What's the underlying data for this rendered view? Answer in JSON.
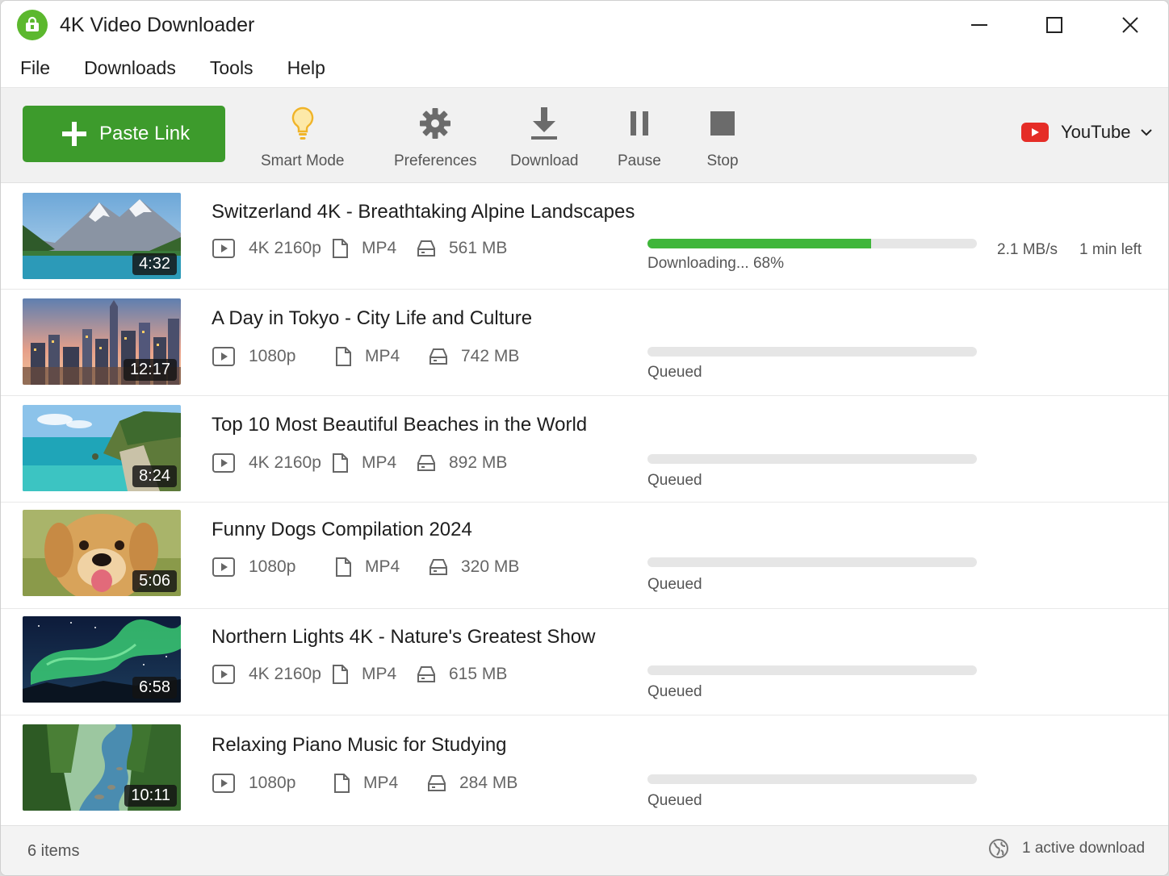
{
  "app": {
    "title": "4K Video Downloader",
    "accent": "#3d9b2c"
  },
  "menu": [
    "File",
    "Downloads",
    "Tools",
    "Help"
  ],
  "toolbar": {
    "paste_label": "Paste Link",
    "smart_mode_label": "Smart Mode",
    "preferences_label": "Preferences",
    "download_label": "Download",
    "pause_label": "Pause",
    "stop_label": "Stop",
    "site": "YouTube"
  },
  "downloads": [
    {
      "title": "Switzerland 4K - Breathtaking Alpine Landscapes",
      "quality": "4K 2160p",
      "format": "MP4",
      "size": "561 MB",
      "duration": "4:32",
      "status": "Downloading... 68%",
      "progress": 0.68,
      "speed": "2.1 MB/s",
      "eta": "1 min left",
      "thumb": "mountain"
    },
    {
      "title": "A Day in Tokyo - City Life and Culture",
      "quality": "1080p",
      "format": "MP4",
      "size": "742 MB",
      "duration": "12:17",
      "status": "Queued",
      "progress": 0,
      "thumb": "city"
    },
    {
      "title": "Top 10 Most Beautiful Beaches in the World",
      "quality": "4K 2160p",
      "format": "MP4",
      "size": "892 MB",
      "duration": "8:24",
      "status": "Queued",
      "progress": 0,
      "thumb": "beach"
    },
    {
      "title": "Funny Dogs Compilation 2024",
      "quality": "1080p",
      "format": "MP4",
      "size": "320 MB",
      "duration": "5:06",
      "status": "Queued",
      "progress": 0,
      "thumb": "dog"
    },
    {
      "title": "Northern Lights 4K - Nature's Greatest Show",
      "quality": "4K 2160p",
      "format": "MP4",
      "size": "615 MB",
      "duration": "6:58",
      "status": "Queued",
      "progress": 0,
      "thumb": "aurora"
    },
    {
      "title": "Relaxing Piano Music for Studying",
      "quality": "1080p",
      "format": "MP4",
      "size": "284 MB",
      "duration": "10:11",
      "status": "Queued",
      "progress": 0,
      "thumb": "forest"
    }
  ],
  "footer": {
    "item_count": "6 items",
    "active": "1 active download"
  }
}
